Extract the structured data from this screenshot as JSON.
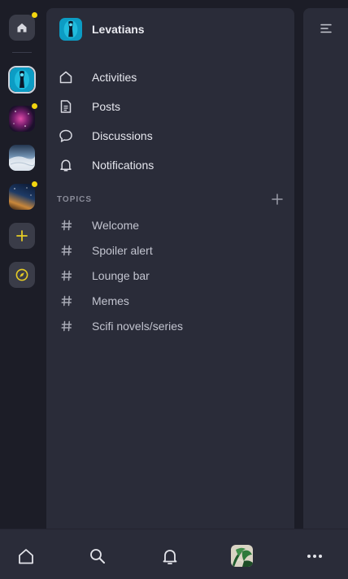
{
  "server": {
    "name": "Levatians"
  },
  "nav": {
    "items": [
      {
        "label": "Activities",
        "icon": "home-icon"
      },
      {
        "label": "Posts",
        "icon": "document-icon"
      },
      {
        "label": "Discussions",
        "icon": "chat-bubble-icon"
      },
      {
        "label": "Notifications",
        "icon": "bell-icon"
      }
    ]
  },
  "topics": {
    "title": "TOPICS",
    "items": [
      {
        "label": "Welcome"
      },
      {
        "label": "Spoiler alert"
      },
      {
        "label": "Lounge bar"
      },
      {
        "label": "Memes"
      },
      {
        "label": "Scifi novels/series"
      }
    ]
  },
  "rail": {
    "items": [
      {
        "name": "home",
        "icon": "home-icon",
        "unread": true
      },
      {
        "name": "levatians",
        "icon": "server-avatar",
        "unread": false,
        "active": true
      },
      {
        "name": "nebula-server",
        "icon": "server-avatar",
        "unread": true
      },
      {
        "name": "earth-server",
        "icon": "server-avatar",
        "unread": false
      },
      {
        "name": "galaxy-server",
        "icon": "server-avatar",
        "unread": true
      },
      {
        "name": "add-server",
        "icon": "plus-icon"
      },
      {
        "name": "explore",
        "icon": "compass-icon"
      }
    ]
  },
  "bottom_nav": {
    "items": [
      {
        "name": "home",
        "icon": "home-icon"
      },
      {
        "name": "search",
        "icon": "search-icon"
      },
      {
        "name": "notifications",
        "icon": "bell-icon"
      },
      {
        "name": "profile",
        "icon": "avatar"
      },
      {
        "name": "more",
        "icon": "more-horizontal-icon"
      }
    ]
  },
  "colors": {
    "background": "#1c1d27",
    "panel": "#2a2c39",
    "unread_dot": "#f2d50f",
    "accent_yellow": "#e6cc25",
    "text": "#e6e7ee"
  }
}
